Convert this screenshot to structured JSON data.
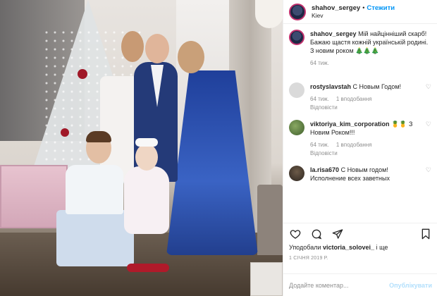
{
  "header": {
    "username": "shahov_sergey",
    "separator": "•",
    "follow_label": "Стежити",
    "location": "Kiev"
  },
  "caption": {
    "username": "shahov_sergey",
    "text": "Мій найцінніший скарб! Бажаю щастя кожній українській родині. З новим роком 🎄🎄🎄",
    "time": "64 тиж."
  },
  "comments": [
    {
      "username": "rostyslavstah",
      "text": "С Новым Годом!",
      "time": "64 тиж.",
      "likes": "1 вподобання",
      "reply": "Відповісти"
    },
    {
      "username": "viktoriya_kim_corporation",
      "text": "🍍🍍 З Новим Роком!!!",
      "time": "64 тиж.",
      "likes": "1 вподобання",
      "reply": "Відповісти"
    },
    {
      "username": "la.risa670",
      "text": "С Новым годом! Исполнение всех заветных",
      "time": "",
      "likes": "",
      "reply": ""
    }
  ],
  "likes": {
    "prefix": "Уподобали",
    "user": "victoria_solovei_",
    "suffix": "і ще"
  },
  "date": "1 СІЧНЯ 2019 Р.",
  "add_comment": {
    "placeholder": "Додайте коментар...",
    "publish_label": "Опублікувати"
  },
  "icons": {
    "like": "heart-icon",
    "comment": "comment-icon",
    "share": "share-icon",
    "save": "bookmark-icon",
    "comment_like": "heart-outline-icon"
  },
  "colors": {
    "accent": "#0095f6",
    "muted": "#8e8e8e",
    "text": "#262626",
    "publish_disabled": "#b2dffc"
  }
}
